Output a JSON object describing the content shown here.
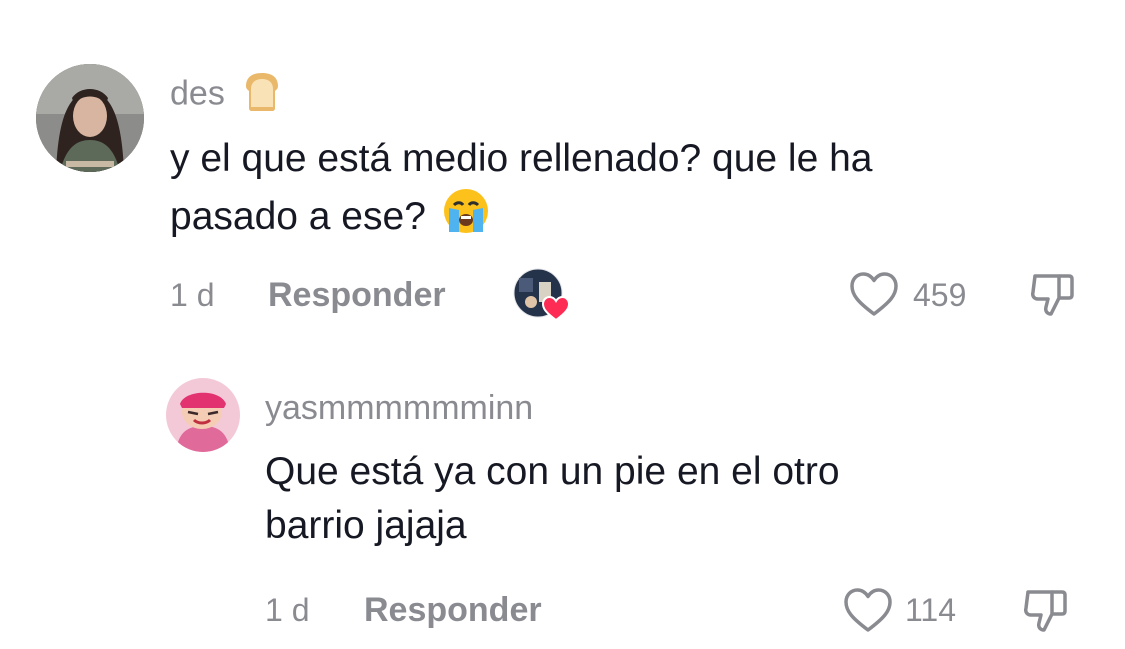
{
  "comments": [
    {
      "username": "des",
      "username_emoji": "bread-icon",
      "text_line1": "y el que está medio rellenado? que le ha",
      "text_line2": "pasado a ese?",
      "text_emoji": "crying-face-icon",
      "time": "1 d",
      "reply_label": "Responder",
      "likes": "459",
      "creator_liked": true
    },
    {
      "username": "yasmmmmmminn",
      "text_line1": "Que está ya con un pie en el otro",
      "text_line2": "barrio jajaja",
      "time": "1 d",
      "reply_label": "Responder",
      "likes": "114"
    }
  ],
  "colors": {
    "text": "#161823",
    "muted": "#8a8b91",
    "heart_badge": "#fe2c55"
  }
}
